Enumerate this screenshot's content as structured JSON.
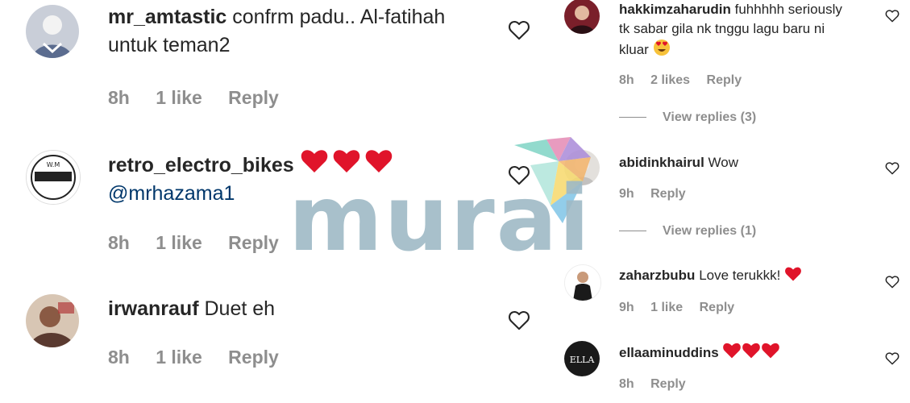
{
  "left_comments": [
    {
      "username": "mr_amtastic",
      "text": "confrm padu.. Al-fatihah untuk teman2",
      "time": "8h",
      "likes": "1 like",
      "reply_label": "Reply"
    },
    {
      "username": "retro_electro_bikes",
      "emoji": "❤️❤️❤️",
      "mention": "@mrhazama1",
      "time": "8h",
      "likes": "1 like",
      "reply_label": "Reply"
    },
    {
      "username": "irwanrauf",
      "text": "Duet eh",
      "time": "8h",
      "likes": "1 like",
      "reply_label": "Reply"
    }
  ],
  "right_comments": [
    {
      "username": "hakkimzaharudin",
      "text": "fuhhhhh seriously tk sabar gila nk tnggu lagu baru ni kluar",
      "emoji": "😍",
      "time": "8h",
      "likes": "2 likes",
      "reply_label": "Reply",
      "view_replies": "View replies (3)"
    },
    {
      "username": "abidinkhairul",
      "text": "Wow",
      "time": "9h",
      "reply_label": "Reply",
      "view_replies": "View replies (1)"
    },
    {
      "username": "zaharzbubu",
      "text": "Love terukkk!",
      "emoji": "❤️",
      "time": "9h",
      "likes": "1 like",
      "reply_label": "Reply"
    },
    {
      "username": "ellaaminuddins",
      "emoji": "❤️❤️❤️",
      "avatar_text": "ELLA",
      "time": "8h",
      "reply_label": "Reply"
    }
  ],
  "avatar_logo_text": "W.M",
  "watermark": "murai",
  "icons": {
    "like": "heart-outline-icon",
    "emoji_heart": "red-heart-icon",
    "emoji_eyes": "heart-eyes-emoji-icon"
  },
  "colors": {
    "text": "#262626",
    "muted": "#8e8e8e",
    "mention": "#00376b",
    "heart_red": "#e0142a",
    "watermark": "#9fbac6"
  }
}
